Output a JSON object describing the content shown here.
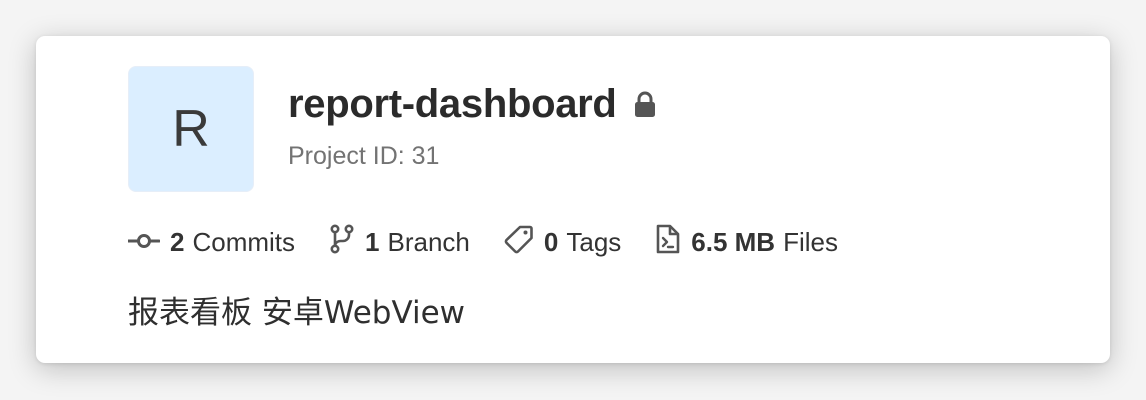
{
  "project": {
    "avatar_letter": "R",
    "name": "report-dashboard",
    "visibility_icon": "lock-icon",
    "id_label": "Project ID: 31",
    "description": "报表看板 安卓WebView"
  },
  "stats": {
    "commits": {
      "count": "2",
      "label": "Commits",
      "icon": "commit-icon"
    },
    "branches": {
      "count": "1",
      "label": "Branch",
      "icon": "branch-icon"
    },
    "tags": {
      "count": "0",
      "label": "Tags",
      "icon": "tag-icon"
    },
    "files": {
      "count": "6.5 MB",
      "label": "Files",
      "icon": "file-icon"
    }
  },
  "colors": {
    "avatar_bg": "#dbeeff",
    "text_primary": "#2b2b2b",
    "text_muted": "#737373",
    "icon": "#555555"
  }
}
